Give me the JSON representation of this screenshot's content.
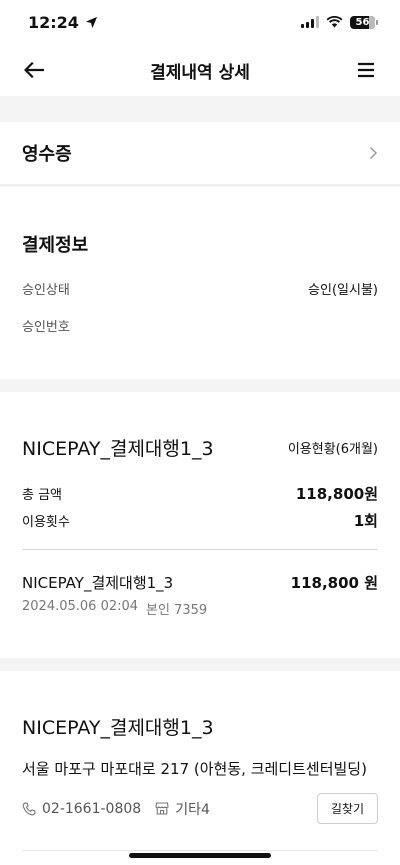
{
  "status_bar": {
    "time": "12:24",
    "battery": "56"
  },
  "header": {
    "title": "결제내역 상세"
  },
  "receipt": {
    "label": "영수증"
  },
  "payment_info": {
    "title": "결제정보",
    "rows": [
      {
        "label": "승인상태",
        "value": "승인(일시불)"
      },
      {
        "label": "승인번호",
        "value": ""
      }
    ]
  },
  "usage": {
    "store_name": "NICEPAY_결제대행1_3",
    "status_label": "이용현황(6개월)",
    "total_label": "총 금액",
    "total_value": "118,800원",
    "count_label": "이용횟수",
    "count_value": "1회",
    "transaction": {
      "name": "NICEPAY_결제대행1_3",
      "amount": "118,800 원",
      "datetime": "2024.05.06 02:04",
      "card": "본인 7359"
    }
  },
  "merchant": {
    "name": "NICEPAY_결제대행1_3",
    "address": "서울 마포구 마포대로 217 (아현동, 크레디트센터빌딩)",
    "phone": "02-1661-0808",
    "category": "기타4",
    "directions_label": "길찾기"
  }
}
